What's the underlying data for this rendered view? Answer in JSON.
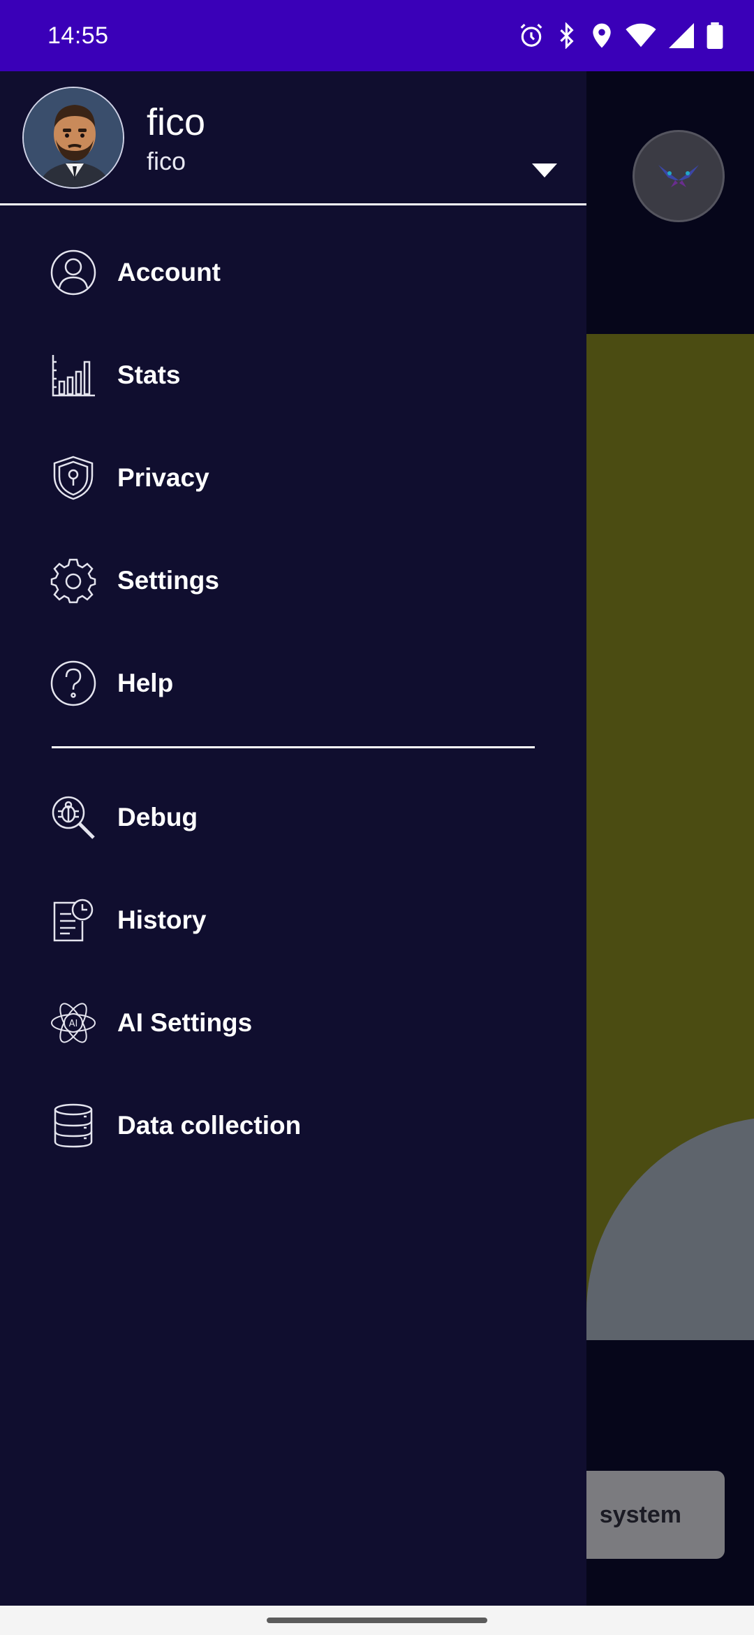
{
  "status_bar": {
    "time": "14:55",
    "icons": [
      "alarm-icon",
      "bluetooth-icon",
      "location-icon",
      "wifi-icon",
      "signal-icon",
      "battery-icon"
    ]
  },
  "drawer": {
    "profile": {
      "name": "fico",
      "handle": "fico"
    },
    "menu_primary": [
      {
        "label": "Account",
        "icon": "account-icon"
      },
      {
        "label": "Stats",
        "icon": "stats-icon"
      },
      {
        "label": "Privacy",
        "icon": "privacy-shield-icon"
      },
      {
        "label": "Settings",
        "icon": "gear-icon"
      },
      {
        "label": "Help",
        "icon": "help-icon"
      }
    ],
    "menu_secondary": [
      {
        "label": "Debug",
        "icon": "debug-icon"
      },
      {
        "label": "History",
        "icon": "history-icon"
      },
      {
        "label": "AI Settings",
        "icon": "ai-settings-icon"
      },
      {
        "label": "Data collection",
        "icon": "database-icon"
      }
    ]
  },
  "background": {
    "button_label": "system"
  },
  "colors": {
    "status_bar": "#3a00b8",
    "drawer_bg": "#100e2f",
    "video_bg": "#4b4c12"
  }
}
